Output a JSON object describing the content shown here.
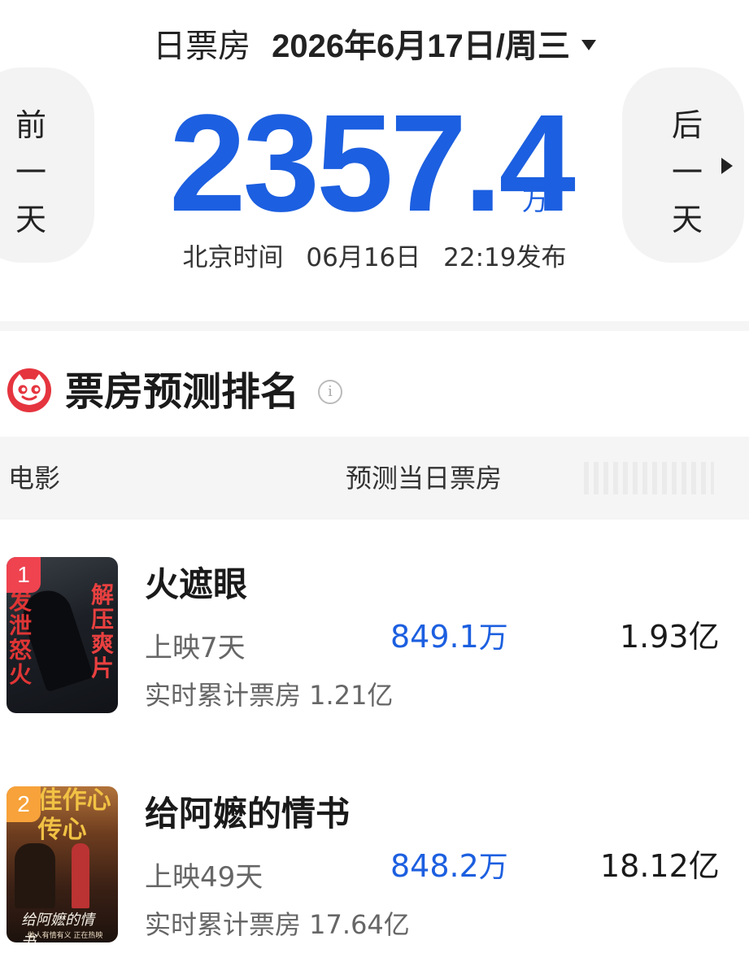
{
  "header": {
    "label": "日票房",
    "date": "2026年6月17日/周三",
    "prev_day": "前一天",
    "next_day": "后一天",
    "total_value": "2357.4",
    "total_unit": "万",
    "release": {
      "prefix": "北京时间",
      "date": "06月16日",
      "time": "22:19发布"
    }
  },
  "section": {
    "title": "票房预测排名",
    "info_glyph": "i"
  },
  "table": {
    "columns": [
      "电影",
      "预测当日票房"
    ]
  },
  "movies": [
    {
      "rank": "1",
      "title": "火遮眼",
      "days": "上映7天",
      "forecast": "849.1",
      "forecast_unit": "万",
      "total": "1.93亿",
      "cumulative": "实时累计票房 1.21亿",
      "poster": {
        "left_text": "发泄怒火",
        "right_text": "解压爽片"
      }
    },
    {
      "rank": "2",
      "title": "给阿嬷的情书",
      "days": "上映49天",
      "forecast": "848.2",
      "forecast_unit": "万",
      "total": "18.12亿",
      "cumulative": "实时累计票房 17.64亿",
      "poster": {
        "top_text": "碑佳作心传心",
        "signature": "给阿嬷的情书",
        "tagline": "做人有情有义 正在热映"
      }
    }
  ],
  "colors": {
    "accent_blue": "#1c5fe0",
    "rank1": "#ef4350",
    "rank2": "#f7a23a",
    "logo_red": "#e5353f"
  }
}
